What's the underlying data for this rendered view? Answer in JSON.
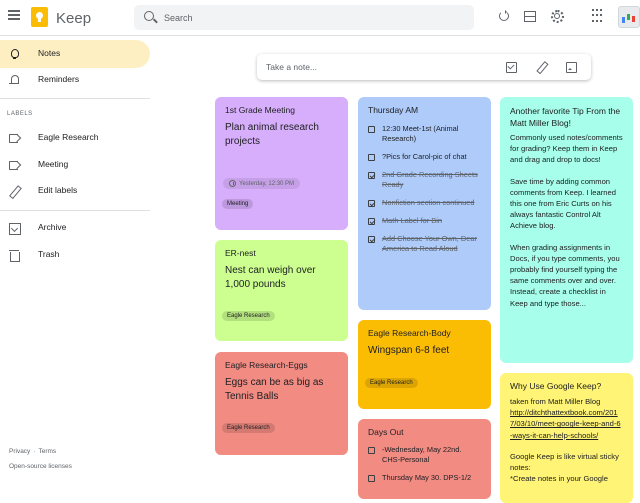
{
  "app": {
    "title": "Keep"
  },
  "search": {
    "placeholder": "Search"
  },
  "take_note": {
    "placeholder": "Take a note..."
  },
  "sidebar": {
    "notes": "Notes",
    "reminders": "Reminders",
    "labels_heading": "LABELS",
    "labels": [
      "Eagle Research",
      "Meeting"
    ],
    "edit_labels": "Edit labels",
    "archive": "Archive",
    "trash": "Trash"
  },
  "footer": {
    "privacy": "Privacy",
    "sep": "·",
    "terms": "Terms",
    "open_source": "Open-source licenses"
  },
  "notes": {
    "first_grade": {
      "title": "1st Grade Meeting",
      "body": "Plan animal research projects",
      "reminder": "Yesterday, 12:30 PM",
      "label": "Meeting",
      "color": "#d7aefb"
    },
    "er_nest": {
      "title": "ER-nest",
      "body": "Nest can weigh over 1,000 pounds",
      "label": "Eagle Research",
      "color": "#ccff90"
    },
    "er_eggs": {
      "title": "Eagle Research-Eggs",
      "body": "Eggs can be as big as Tennis Balls",
      "label": "Eagle Research",
      "color": "#f28b82"
    },
    "thursday": {
      "title": "Thursday AM",
      "color": "#aecbfa",
      "items": [
        {
          "text": "12:30 Meet-1st (Animal Research)",
          "checked": false
        },
        {
          "text": "?Pics for Carol-pic of chat",
          "checked": false
        },
        {
          "text": "2nd Grade Recording Sheets Ready",
          "checked": true
        },
        {
          "text": "Nonfiction section continued",
          "checked": true
        },
        {
          "text": "Math Label for Bin",
          "checked": true
        },
        {
          "text": "Add Choose Your Own, Dear America to Read Aloud",
          "checked": true
        }
      ]
    },
    "er_body": {
      "title": "Eagle Research-Body",
      "body": "Wingspan 6-8 feet",
      "label": "Eagle Research",
      "color": "#fbbc04"
    },
    "days_out": {
      "title": "Days Out",
      "color": "#f28b82",
      "items": [
        {
          "text": "-Wednesday, May 22nd. CHS-Personal",
          "checked": false
        },
        {
          "text": "Thursday May 30. DPS-1/2",
          "checked": false
        }
      ]
    },
    "tip": {
      "title": "Another favorite Tip From the Matt Miller Blog!",
      "color": "#a7ffeb",
      "p1": "Commonly used notes/comments for grading? Keep them in Keep and drag and drop to docs!",
      "p2": "Save time by adding common comments from Keep. I learned this one from Eric Curts on his always fantastic Control Alt Achieve blog.",
      "p3": "When grading assignments in Docs, if you type comments, you probably find yourself typing the same comments over and over. Instead, create a checklist in Keep and type those..."
    },
    "why": {
      "title": "Why Use Google Keep?",
      "color": "#fff475",
      "source": "taken from Matt Miller Blog",
      "url": "http://ditchthattextbook.com/2017/03/10/meet-google-keep-and-6-ways-it-can-help-schools/",
      "p1": "Google Keep is like virtual sticky notes:",
      "p2": "*Create notes in your Google"
    }
  }
}
